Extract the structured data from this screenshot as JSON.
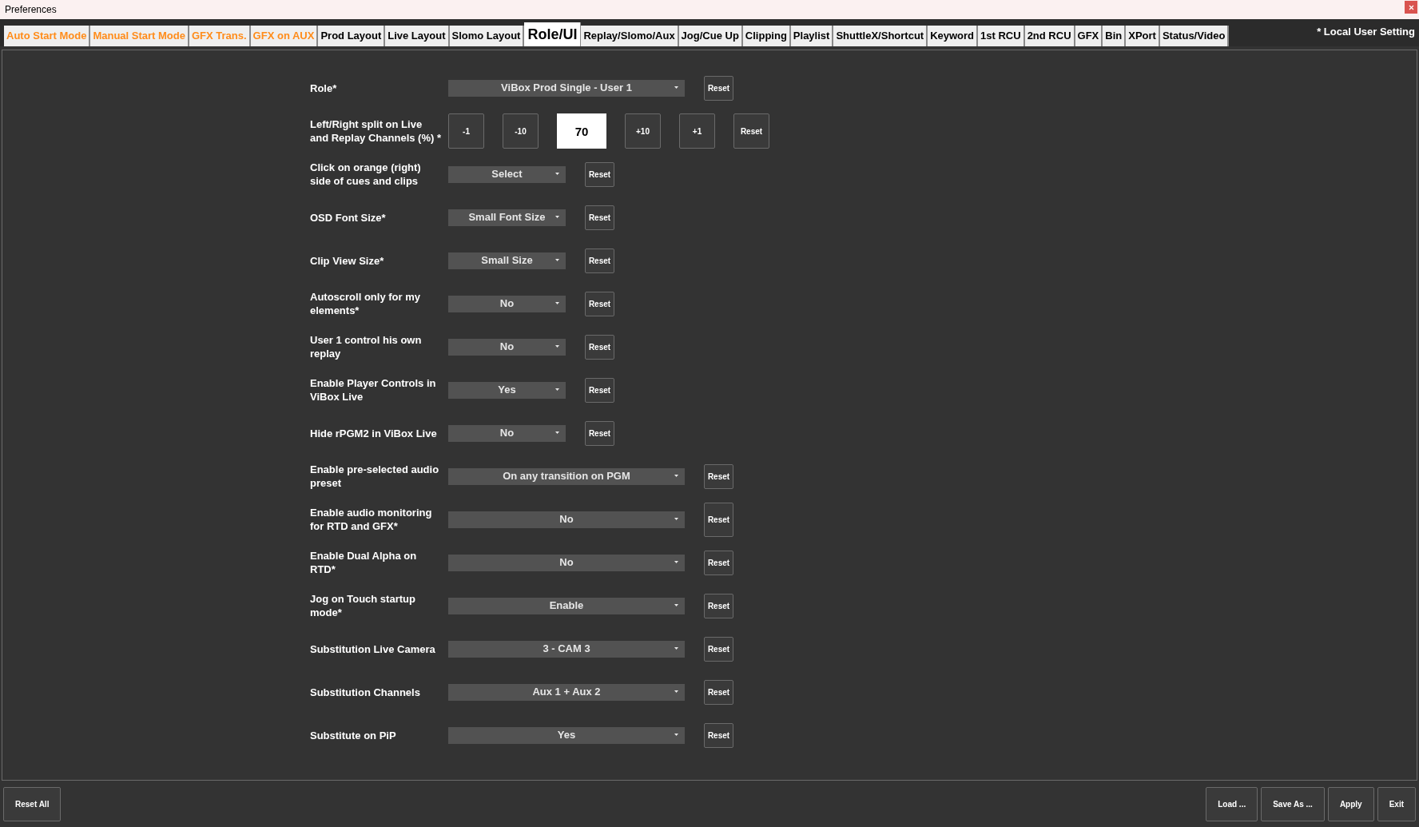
{
  "window": {
    "title": "Preferences"
  },
  "tabs": [
    {
      "label": "Auto Start Mode",
      "selected": false,
      "color": "#ff8c1a"
    },
    {
      "label": "Manual Start Mode",
      "selected": false,
      "color": "#ff8c1a"
    },
    {
      "label": "GFX Trans.",
      "selected": false,
      "color": "#ff8c1a"
    },
    {
      "label": "GFX on AUX",
      "selected": false,
      "color": "#ff8c1a"
    },
    {
      "label": "Prod Layout",
      "selected": false,
      "color": "#000000"
    },
    {
      "label": "Live Layout",
      "selected": false,
      "color": "#000000"
    },
    {
      "label": "Slomo Layout",
      "selected": false,
      "color": "#000000"
    },
    {
      "label": "Role/UI",
      "selected": true,
      "color": "#000000"
    },
    {
      "label": "Replay/Slomo/Aux",
      "selected": false,
      "color": "#000000"
    },
    {
      "label": "Jog/Cue Up",
      "selected": false,
      "color": "#000000"
    },
    {
      "label": "Clipping",
      "selected": false,
      "color": "#000000"
    },
    {
      "label": "Playlist",
      "selected": false,
      "color": "#000000"
    },
    {
      "label": "ShuttleX/Shortcut",
      "selected": false,
      "color": "#000000"
    },
    {
      "label": "Keyword",
      "selected": false,
      "color": "#000000"
    },
    {
      "label": "1st RCU",
      "selected": false,
      "color": "#000000"
    },
    {
      "label": "2nd RCU",
      "selected": false,
      "color": "#000000"
    },
    {
      "label": "GFX",
      "selected": false,
      "color": "#000000"
    },
    {
      "label": "Bin",
      "selected": false,
      "color": "#000000"
    },
    {
      "label": "XPort",
      "selected": false,
      "color": "#000000"
    },
    {
      "label": "Status/Video",
      "selected": false,
      "color": "#000000"
    }
  ],
  "legend": "* Local User Setting",
  "settings": [
    {
      "kind": "dropdown-wide",
      "label": "Role*",
      "value": "ViBox Prod Single - User 1",
      "reset": "Reset"
    },
    {
      "kind": "stepper",
      "label": "Left/Right split on Live and Replay Channels (%) *",
      "buttons_before": [
        "-1",
        "-10"
      ],
      "value": "70",
      "buttons_after": [
        "+10",
        "+1"
      ],
      "reset": "Reset"
    },
    {
      "kind": "dropdown",
      "label": "Click on orange (right) side of cues and clips",
      "value": "Select",
      "reset": "Reset"
    },
    {
      "kind": "dropdown",
      "label": "OSD Font Size*",
      "value": "Small Font Size",
      "reset": "Reset"
    },
    {
      "kind": "dropdown",
      "label": "Clip View Size*",
      "value": "Small Size",
      "reset": "Reset"
    },
    {
      "kind": "dropdown",
      "label": "Autoscroll only for my elements*",
      "value": "No",
      "reset": "Reset"
    },
    {
      "kind": "dropdown",
      "label": "User 1 control his own replay",
      "value": "No",
      "reset": "Reset"
    },
    {
      "kind": "dropdown",
      "label": "Enable Player Controls in ViBox Live",
      "value": "Yes",
      "reset": "Reset"
    },
    {
      "kind": "dropdown",
      "label": "Hide rPGM2 in ViBox Live",
      "value": "No",
      "reset": "Reset"
    },
    {
      "kind": "dropdown-wide",
      "label": "Enable pre-selected audio preset",
      "value": "On any transition on PGM",
      "reset": "Reset"
    },
    {
      "kind": "dropdown-wide",
      "label": "Enable audio monitoring for RTD and GFX*",
      "value": "No",
      "reset": "Reset"
    },
    {
      "kind": "dropdown-wide",
      "label": "Enable Dual Alpha on RTD*",
      "value": "No",
      "reset": "Reset"
    },
    {
      "kind": "dropdown-wide",
      "label": "Jog on Touch startup mode*",
      "value": "Enable",
      "reset": "Reset"
    },
    {
      "kind": "dropdown-wide",
      "label": "Substitution Live Camera",
      "value": "3 - CAM 3",
      "reset": "Reset"
    },
    {
      "kind": "dropdown-wide",
      "label": "Substitution Channels",
      "value": "Aux 1 + Aux 2",
      "reset": "Reset"
    },
    {
      "kind": "dropdown-wide",
      "label": "Substitute on PiP",
      "value": "Yes",
      "reset": "Reset"
    }
  ],
  "footer": {
    "left": [
      "Reset All"
    ],
    "right": [
      "Load ...",
      "Save As ...",
      "Apply",
      "Exit"
    ]
  }
}
